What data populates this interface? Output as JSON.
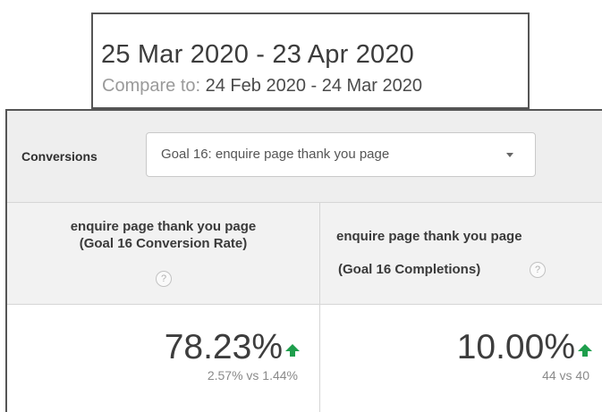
{
  "date_range": {
    "main": "25 Mar 2020 - 23 Apr 2020",
    "compare_label": "Compare to:",
    "compare_value": "24 Feb 2020 - 24 Mar 2020"
  },
  "toolbar": {
    "conversions_label": "Conversions",
    "goal_select": "Goal 16: enquire page thank you page"
  },
  "metrics": [
    {
      "header_line1": "enquire page thank you page",
      "header_line2": "(Goal 16 Conversion Rate)",
      "help": "?",
      "value": "78.23%",
      "comparison": "2.57% vs 1.44%",
      "trend": "up"
    },
    {
      "header_line1": "enquire page thank you page",
      "header_line2": "(Goal 16 Completions)",
      "help": "?",
      "value": "10.00%",
      "comparison": "44 vs 40",
      "trend": "up"
    }
  ],
  "colors": {
    "trend_up": "#1e9e4c",
    "toolbar_bg": "#eeeeee",
    "header_bg": "#f2f2f2"
  }
}
